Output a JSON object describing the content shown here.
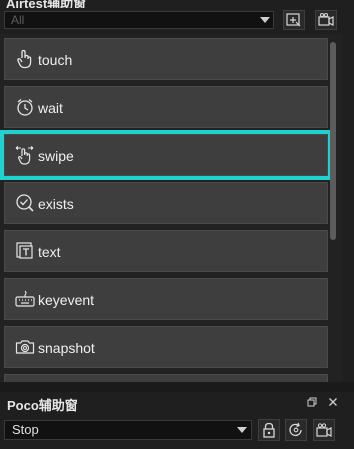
{
  "panel": {
    "title": "Airtest辅助窗",
    "filter_value": "All"
  },
  "actions": [
    {
      "label": "touch",
      "icon": "touch-hand-icon"
    },
    {
      "label": "wait",
      "icon": "clock-icon"
    },
    {
      "label": "swipe",
      "icon": "swipe-hand-icon",
      "selected": true
    },
    {
      "label": "exists",
      "icon": "check-circle-icon"
    },
    {
      "label": "text",
      "icon": "text-box-icon"
    },
    {
      "label": "keyevent",
      "icon": "keyboard-icon"
    },
    {
      "label": "snapshot",
      "icon": "camera-icon"
    }
  ],
  "poco": {
    "title": "Poco辅助窗",
    "mode_value": "Stop",
    "tool_icons": [
      "lock-icon",
      "refresh-icon",
      "record-icon"
    ]
  },
  "colors": {
    "selection_outline": "#1fd1cf",
    "item_bg": "#3e3e3e",
    "panel_bg": "#1f1f1f"
  }
}
